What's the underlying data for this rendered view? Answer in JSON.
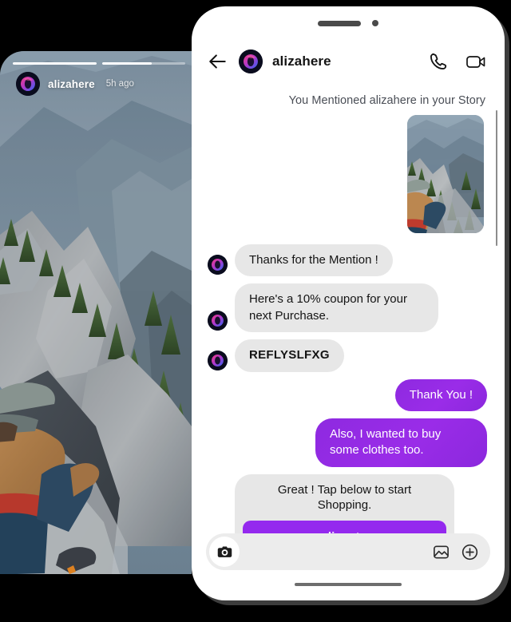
{
  "colors": {
    "page_background": "#000000",
    "accent_purple": "#9429EE",
    "outgoing_bubble": "#8E2AE0",
    "incoming_bubble": "#E7E7E7",
    "phone_background": "#FFFFFF",
    "text_primary": "#141414"
  },
  "story_phone": {
    "username": "alizahere",
    "timestamp": "5h ago",
    "avatar_icon": "alizahere-avatar-icon",
    "progress_bars": [
      {
        "fill_percent": 100
      },
      {
        "fill_percent": 60
      }
    ],
    "photo_alt": "mountain-landscape-hiker-on-cliff"
  },
  "chat_phone": {
    "header": {
      "back_icon": "back-arrow-icon",
      "avatar_icon": "alizahere-avatar-icon",
      "username": "alizahere",
      "call_icon": "phone-call-icon",
      "video_icon": "video-camera-icon"
    },
    "mention_note": "You Mentioned alizahere in your Story",
    "story_attachment": {
      "alt": "mountain-landscape-hiker-on-cliff-thumbnail"
    },
    "messages": [
      {
        "id": "msg-thanks",
        "direction": "incoming",
        "text": "Thanks for the Mention !",
        "style": "normal"
      },
      {
        "id": "msg-coupon",
        "direction": "incoming",
        "text": "Here's a 10% coupon for your next Purchase.",
        "style": "normal"
      },
      {
        "id": "msg-code",
        "direction": "incoming",
        "text": "REFLYSLFXG",
        "style": "code"
      },
      {
        "id": "msg-thankyou",
        "direction": "outgoing",
        "text": "Thank You !",
        "style": "normal"
      },
      {
        "id": "msg-clothes",
        "direction": "outgoing",
        "text": "Also, I wanted to buy some clothes too.",
        "style": "normal"
      },
      {
        "id": "msg-cta",
        "direction": "incoming",
        "text": "Great ! Tap below to start Shopping.",
        "style": "cta",
        "button_label": "www.onlinestore.com"
      }
    ],
    "input_bar": {
      "camera_icon": "camera-icon",
      "placeholder": "",
      "value": "",
      "gallery_icon": "image-gallery-icon",
      "plus_icon": "plus-circle-icon"
    }
  }
}
